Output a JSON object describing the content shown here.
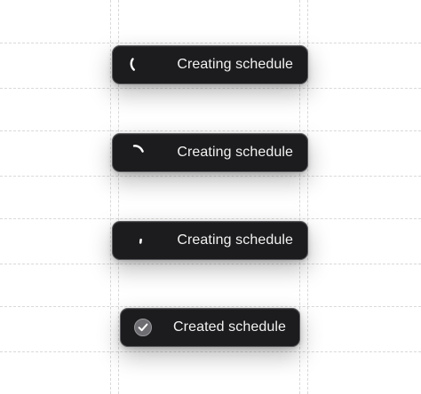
{
  "toasts": [
    {
      "state": "loading",
      "label": "Creating schedule",
      "icon": "spinner-icon"
    },
    {
      "state": "loading",
      "label": "Creating schedule",
      "icon": "spinner-icon"
    },
    {
      "state": "loading",
      "label": "Creating schedule",
      "icon": "spinner-icon"
    },
    {
      "state": "success",
      "label": "Created schedule",
      "icon": "check-circle-icon"
    }
  ],
  "colors": {
    "background": "#ffffff",
    "pill": "#1c1c1e",
    "pill_border": "#5a5a5e",
    "text": "#f2f2f2",
    "guide": "#d9d9d9",
    "check_circle": "#6e6e72"
  }
}
